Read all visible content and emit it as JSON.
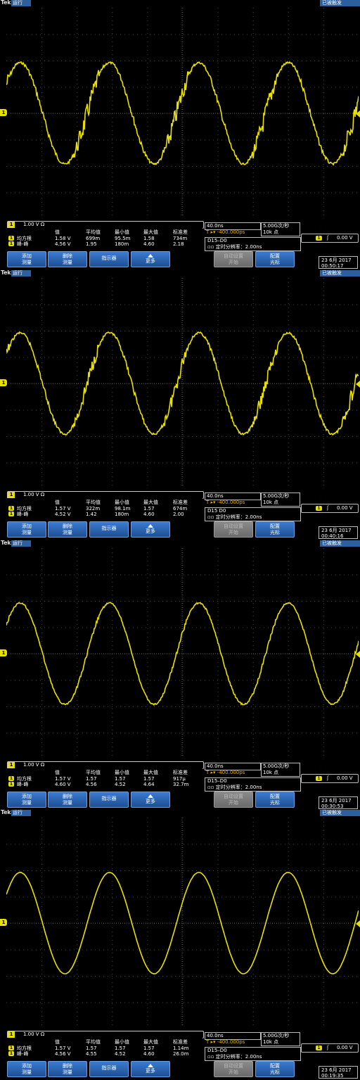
{
  "colors": {
    "trace": "#e8e000",
    "accent": "#2b5f9e",
    "grid": "#555555"
  },
  "screens": [
    {
      "brand": "Tek",
      "mode": "运行",
      "trigger_state": "已被触发",
      "channel_label": "1",
      "scale": "1.00 V Ω",
      "measure_header": [
        "值",
        "平均值",
        "最小值",
        "最大值",
        "标准差"
      ],
      "measure_rows": [
        {
          "badge": "1",
          "name": "均方根",
          "values": [
            "1.58 V",
            "699m",
            "95.5m",
            "1.58",
            "734m"
          ]
        },
        {
          "badge": "1",
          "name": "峰-峰",
          "values": [
            "4.56 V",
            "1.95",
            "180m",
            "4.60",
            "2.18"
          ]
        }
      ],
      "timebase": "40.0ns",
      "delay": "T ▸▾ -400.000ps",
      "sample_rate": "5.00G次/秒",
      "record_length": "10k 点",
      "digital": "D15–D0",
      "digital_sub": "▫▫ 定时分辨率：2.00ns",
      "trigger_level": "0.00 V",
      "slope": "ʃ",
      "buttons": {
        "add": "添加\n测量",
        "delete": "删除\n测量",
        "indicator": "指示器",
        "more": "更多",
        "autoset": "自动设置\n开始",
        "config": "配置\n光标"
      },
      "date": "23 6月  2017",
      "time": "00:50:17",
      "noise": 1.0
    },
    {
      "brand": "Tek",
      "mode": "运行",
      "trigger_state": "已被触发",
      "channel_label": "1",
      "scale": "1.00 V Ω",
      "measure_header": [
        "值",
        "平均值",
        "最小值",
        "最大值",
        "标准差"
      ],
      "measure_rows": [
        {
          "badge": "1",
          "name": "均方根",
          "values": [
            "1.57 V",
            "322m",
            "98.1m",
            "1.57",
            "674m"
          ]
        },
        {
          "badge": "1",
          "name": "峰-峰",
          "values": [
            "4.52 V",
            "1.42",
            "180m",
            "4.60",
            "2.00"
          ]
        }
      ],
      "timebase": "40.0ns",
      "delay": "T ▸▾ -400.000ps",
      "sample_rate": "5.00G次/秒",
      "record_length": "10k 点",
      "digital": "D15  D0",
      "digital_sub": "▫▫ 定时分辨率：2.00ns",
      "trigger_level": "0.00 V",
      "slope": "ʃ",
      "buttons": {
        "add": "添加\n测量",
        "delete": "删除\n测量",
        "indicator": "指示器",
        "more": "更多",
        "autoset": "自动设置\n开始",
        "config": "配置\n光标"
      },
      "date": "23 6月  2017",
      "time": "00:40:16",
      "noise": 0.75
    },
    {
      "brand": "Tek",
      "mode": "运行",
      "trigger_state": "已被触发",
      "channel_label": "1",
      "scale": "1.00 V Ω",
      "measure_header": [
        "值",
        "平均值",
        "最小值",
        "最大值",
        "标准差"
      ],
      "measure_rows": [
        {
          "badge": "1",
          "name": "均方根",
          "values": [
            "1.57 V",
            "1.57",
            "1.57",
            "1.57",
            "917μ"
          ]
        },
        {
          "badge": "1",
          "name": "峰-峰",
          "values": [
            "4.60 V",
            "4.56",
            "4.52",
            "4.64",
            "32.7m"
          ]
        }
      ],
      "timebase": "40.0ns",
      "delay": "T ▸▾ -400.000ps",
      "sample_rate": "5.00G次/秒",
      "record_length": "10k 点",
      "digital": "D15–D0",
      "digital_sub": "▫▫ 定时分辨率：2.00ns",
      "trigger_level": "0.00 V",
      "slope": "ʃ",
      "buttons": {
        "add": "添加\n测量",
        "delete": "删除\n测量",
        "indicator": "指示器",
        "more": "更多",
        "autoset": "自动设置\n开始",
        "config": "配置\n光标"
      },
      "date": "23 6月  2017",
      "time": "00:30:53",
      "noise": 0.15
    },
    {
      "brand": "Tek",
      "mode": "运行",
      "trigger_state": "已被触发",
      "channel_label": "1",
      "scale": "1.00 V Ω",
      "measure_header": [
        "值",
        "平均值",
        "最小值",
        "最大值",
        "标准差"
      ],
      "measure_rows": [
        {
          "badge": "1",
          "name": "均方根",
          "values": [
            "1.57 V",
            "1.57",
            "1.57",
            "1.57",
            "1.14m"
          ]
        },
        {
          "badge": "1",
          "name": "峰-峰",
          "values": [
            "4.56 V",
            "4.55",
            "4.52",
            "4.60",
            "26.0m"
          ]
        }
      ],
      "timebase": "40.0ns",
      "delay": "T ▸▾ -400.000ps",
      "sample_rate": "5.00G次/秒",
      "record_length": "10k 点",
      "digital": "D15–D0",
      "digital_sub": "▫▫ 定时分辨率：2.00ns",
      "trigger_level": "0.00 V",
      "slope": "ʃ",
      "buttons": {
        "add": "添加\n测量",
        "delete": "删除\n测量",
        "indicator": "指示器",
        "more": "更多",
        "autoset": "自动设置\n开始",
        "config": "配置\n光标"
      },
      "date": "23 6月  2017",
      "time": "00:19:35",
      "noise": 0.05
    }
  ]
}
